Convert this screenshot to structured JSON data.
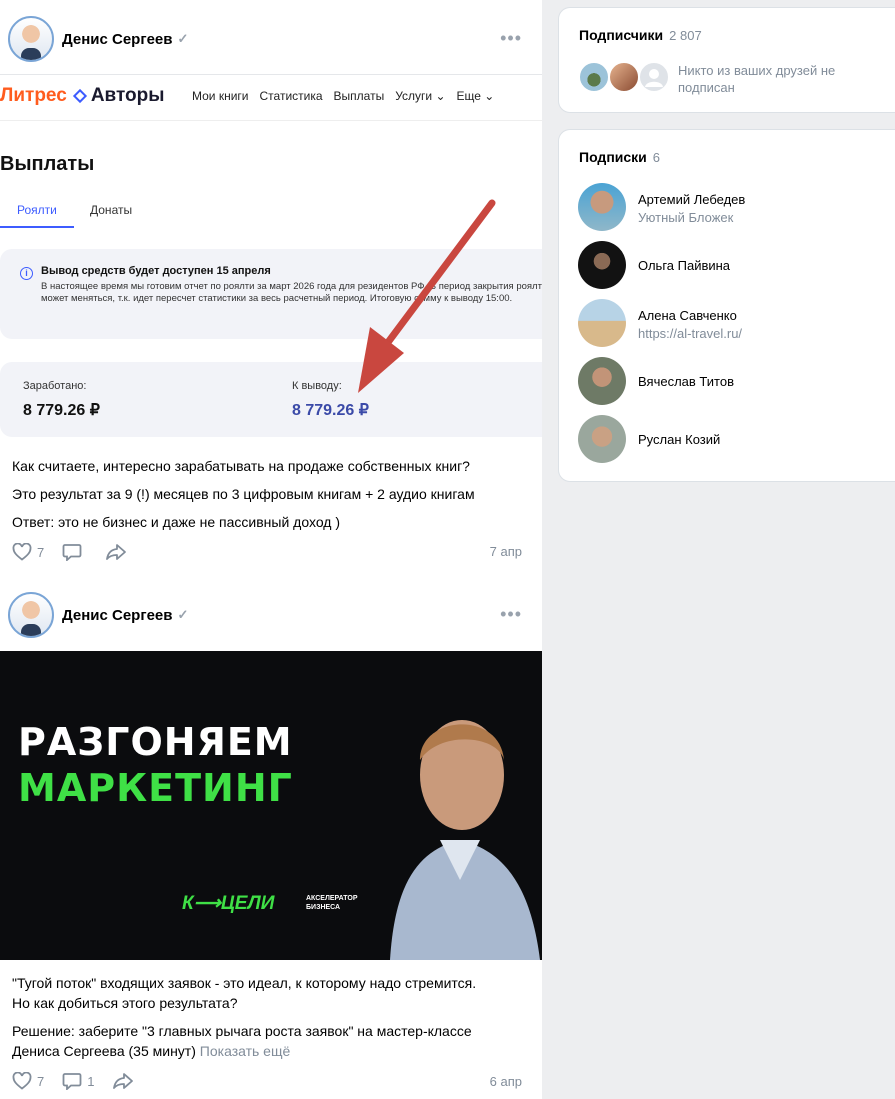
{
  "post1": {
    "author": "Денис Сергеев",
    "screenshot": {
      "logo_a": "Литрес",
      "logo_b": "Авторы",
      "nav": [
        "Мои книги",
        "Статистика",
        "Выплаты",
        "Услуги",
        "Еще"
      ],
      "title": "Выплаты",
      "tabs": [
        "Роялти",
        "Донаты"
      ],
      "info_title": "Вывод средств будет доступен 15 апреля",
      "info_body": "В настоящее время мы готовим отчет по роялти за март 2026 года для резидентов РФ. В период закрытия роялти может меняться, т.к. идет пересчет статистики за весь расчетный период. Итоговую сумму к выводу 15:00.",
      "earned_label": "Заработано:",
      "earned_value": "8 779.26 ₽",
      "withdraw_label": "К выводу:",
      "withdraw_value": "8 779.26 ₽"
    },
    "text": [
      "Как считаете, интересно зарабатывать на продаже собственных книг?",
      "Это результат за 9 (!) месяцев по 3 цифровым книгам + 2 аудио книгам",
      "Ответ: это не бизнес и даже не пассивный доход )"
    ],
    "likes": "7",
    "date": "7 апр"
  },
  "post2": {
    "author": "Денис Сергеев",
    "banner": {
      "line1": "РАЗГОНЯЕМ",
      "line2": "МАРКЕТИНГ",
      "brand": "К⟶ЦЕЛИ",
      "brand_sub1": "АКСЕЛЕРАТОР",
      "brand_sub2": "БИЗНЕСА"
    },
    "text1a": "\"Тугой поток\" входящих заявок - это идеал, к которому надо стремится.",
    "text1b": "Но как добиться этого результата?",
    "text2a": "Решение: заберите \"3 главных рычага роста заявок\" на мастер-классе",
    "text2b": "Дениса Сергеева (35 минут)",
    "show_more": "Показать ещё",
    "likes": "7",
    "comments": "1",
    "date": "6 апр"
  },
  "followers": {
    "title": "Подписчики",
    "count": "2 807",
    "note": "Никто из ваших друзей не подписан"
  },
  "subscriptions": {
    "title": "Подписки",
    "count": "6",
    "items": [
      {
        "name": "Артемий Лебедев",
        "desc": "Уютный Бложек"
      },
      {
        "name": "Ольга Пайвина",
        "desc": ""
      },
      {
        "name": "Алена Савченко",
        "desc": "https://al-travel.ru/"
      },
      {
        "name": "Вячеслав Титов",
        "desc": ""
      },
      {
        "name": "Руслан Козий",
        "desc": ""
      }
    ]
  },
  "colors": {
    "accent": "#3d5cff",
    "banner_green": "#3fe046",
    "arrow": "#c9473f"
  }
}
